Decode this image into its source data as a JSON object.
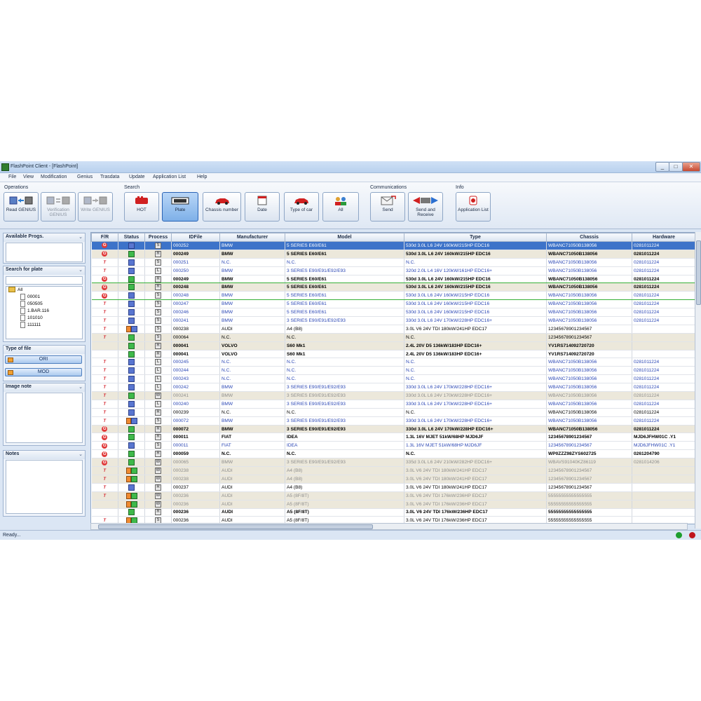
{
  "window": {
    "title": "FlashPoint Client - [FlashPoint]",
    "min": "_",
    "max": "□",
    "close": "✕"
  },
  "menu": [
    "File",
    "View",
    "Modification",
    "Genius",
    "Trasdata",
    "Update",
    "Application List",
    "Help"
  ],
  "toolbar": {
    "groups": {
      "operations": "Operations",
      "search": "Search",
      "communications": "Communications",
      "info": "Info"
    },
    "operations": [
      {
        "label": "Read GENIUS"
      },
      {
        "label": "Verification GENIUS"
      },
      {
        "label": "Write GENIUS"
      }
    ],
    "search": [
      {
        "label": "HOT"
      },
      {
        "label": "Plate"
      },
      {
        "label": "Chassis number"
      },
      {
        "label": "Date"
      },
      {
        "label": "Type of car"
      },
      {
        "label": "All"
      }
    ],
    "communications": [
      {
        "label": "Send"
      },
      {
        "label": "Send and Receive"
      }
    ],
    "info": [
      {
        "label": "Application List"
      }
    ]
  },
  "left": {
    "available": "Available Progs.",
    "search_plate": "Search for plate",
    "tree": [
      "All",
      "00001",
      "050505",
      "1.BAR.116",
      "101010",
      "111111"
    ],
    "type_of_file": "Type of file",
    "ori": "ORI",
    "mod": "MOD",
    "image_note": "Image note",
    "notes": "Notes",
    "chevron": "⌄"
  },
  "grid": {
    "columns": [
      "F/R",
      "Status",
      "Process",
      "IDFile",
      "Manufacturer",
      "Model",
      "Type",
      "Chassis",
      "Hardware"
    ],
    "rows": [
      {
        "fr": "G",
        "st": [
          "b"
        ],
        "pr": "S",
        "id": "000252",
        "man": "BMW",
        "model": "5 SERIES E60/E61",
        "type": "530d 3.0L L6 24V 160kW/215HP EDC16",
        "chassis": "WBANC71050B138056",
        "hw": "0281011224",
        "cls": "sel"
      },
      {
        "fr": "G",
        "st": [
          "g"
        ],
        "pr": "R",
        "id": "000249",
        "man": "BMW",
        "model": "5 SERIES E60/E61",
        "type": "530d 3.0L L6 24V 160kW/215HP EDC16",
        "chassis": "WBANC71050B138056",
        "hw": "0281011224",
        "cls": "bold c-black bg-b"
      },
      {
        "fr": "T",
        "st": [
          "b"
        ],
        "pr": "S",
        "id": "000251",
        "man": "N.C.",
        "model": "N.C.",
        "type": "N.C.",
        "chassis": "WBANC71050B138056",
        "hw": "0281011224",
        "cls": "c-blue bg-w"
      },
      {
        "fr": "T",
        "st": [
          "b"
        ],
        "pr": "L",
        "id": "000250",
        "man": "BMW",
        "model": "3 SERIES E90/E91/E92/E93",
        "type": "320d 2.0L L4 16V 120kW/161HP EDC16+",
        "chassis": "WBANC71050B138056",
        "hw": "0281011224",
        "cls": "c-blue bg-w"
      },
      {
        "fr": "G",
        "st": [
          "g"
        ],
        "pr": "R",
        "id": "000249",
        "man": "BMW",
        "model": "5 SERIES E60/E61",
        "type": "530d 3.0L L6 24V 160kW/215HP EDC16",
        "chassis": "WBANC71050B138056",
        "hw": "0281011224",
        "cls": "bold c-black bg-w grn"
      },
      {
        "fr": "G",
        "st": [
          "g"
        ],
        "pr": "R",
        "id": "000248",
        "man": "BMW",
        "model": "5 SERIES E60/E61",
        "type": "530d 3.0L L6 24V 160kW/215HP EDC16",
        "chassis": "WBANC71050B138056",
        "hw": "0281011224",
        "cls": "bold c-black bg-b"
      },
      {
        "fr": "G",
        "st": [
          "b"
        ],
        "pr": "S",
        "id": "000248",
        "man": "BMW",
        "model": "5 SERIES E60/E61",
        "type": "530d 3.0L L6 24V 160kW/215HP EDC16",
        "chassis": "WBANC71050B138056",
        "hw": "0281011224",
        "cls": "c-blue bg-w grn"
      },
      {
        "fr": "T",
        "st": [
          "b"
        ],
        "pr": "S",
        "id": "000247",
        "man": "BMW",
        "model": "5 SERIES E60/E61",
        "type": "530d 3.0L L6 24V 160kW/215HP EDC16",
        "chassis": "WBANC71050B138056",
        "hw": "0281011224",
        "cls": "c-blue bg-w"
      },
      {
        "fr": "T",
        "st": [
          "b"
        ],
        "pr": "S",
        "id": "000246",
        "man": "BMW",
        "model": "5 SERIES E60/E61",
        "type": "530d 3.0L L6 24V 160kW/215HP EDC16",
        "chassis": "WBANC71050B138056",
        "hw": "0281011224",
        "cls": "c-blue bg-w"
      },
      {
        "fr": "T",
        "st": [
          "b"
        ],
        "pr": "S",
        "id": "000241",
        "man": "BMW",
        "model": "3 SERIES E90/E91/E92/E93",
        "type": "330d 3.0L L6 24V 170kW/228HP EDC16+",
        "chassis": "WBANC71050B138056",
        "hw": "0281011224",
        "cls": "c-blue bg-w"
      },
      {
        "fr": "T",
        "st": [
          "o",
          "b"
        ],
        "pr": "S",
        "id": "000238",
        "man": "AUDI",
        "model": "A4 (B8)",
        "type": "3.0L V6 24V TDI 180kW/241HP EDC17",
        "chassis": "12345678901234567",
        "hw": "",
        "cls": "c-black bg-w"
      },
      {
        "fr": "T",
        "st": [
          "g"
        ],
        "pr": "S",
        "id": "000064",
        "man": "N.C.",
        "model": "N.C.",
        "type": "N.C.",
        "chassis": "12345678901234567",
        "hw": "",
        "cls": "c-black bg-b"
      },
      {
        "fr": "",
        "st": [
          "g"
        ],
        "pr": "R",
        "id": "000041",
        "man": "VOLVO",
        "model": "S60 Mk1",
        "type": "2.4L 20V D5 136kW/183HP EDC16+",
        "chassis": "YV1RS714092720720",
        "hw": "",
        "cls": "bold c-black bg-b"
      },
      {
        "fr": "",
        "st": [
          "g"
        ],
        "pr": "R",
        "id": "000041",
        "man": "VOLVO",
        "model": "S60 Mk1",
        "type": "2.4L 20V D5 136kW/183HP EDC16+",
        "chassis": "YV1RS714092720720",
        "hw": "",
        "cls": "bold c-black bg-w"
      },
      {
        "fr": "T",
        "st": [
          "b"
        ],
        "pr": "L",
        "id": "000245",
        "man": "N.C.",
        "model": "N.C.",
        "type": "N.C.",
        "chassis": "WBANC71050B138056",
        "hw": "0281011224",
        "cls": "c-blue bg-w"
      },
      {
        "fr": "T",
        "st": [
          "b"
        ],
        "pr": "L",
        "id": "000244",
        "man": "N.C.",
        "model": "N.C.",
        "type": "N.C.",
        "chassis": "WBANC71050B138056",
        "hw": "0281011224",
        "cls": "c-blue bg-w"
      },
      {
        "fr": "T",
        "st": [
          "b"
        ],
        "pr": "L",
        "id": "000243",
        "man": "N.C.",
        "model": "N.C.",
        "type": "N.C.",
        "chassis": "WBANC71050B138056",
        "hw": "0281011224",
        "cls": "c-blue bg-w"
      },
      {
        "fr": "T",
        "st": [
          "b"
        ],
        "pr": "L",
        "id": "000242",
        "man": "BMW",
        "model": "3 SERIES E90/E91/E92/E93",
        "type": "330d 3.0L L6 24V 170kW/228HP EDC16+",
        "chassis": "WBANC71050B138056",
        "hw": "0281011224",
        "cls": "c-blue bg-w"
      },
      {
        "fr": "T",
        "st": [
          "g"
        ],
        "pr": "W",
        "id": "000241",
        "man": "BMW",
        "model": "3 SERIES E90/E91/E92/E93",
        "type": "330d 3.0L L6 24V 170kW/228HP EDC16+",
        "chassis": "WBANC71050B138056",
        "hw": "0281011224",
        "cls": "c-gray bg-b"
      },
      {
        "fr": "T",
        "st": [
          "b"
        ],
        "pr": "L",
        "id": "000240",
        "man": "BMW",
        "model": "3 SERIES E90/E91/E92/E93",
        "type": "330d 3.0L L6 24V 170kW/228HP EDC16+",
        "chassis": "WBANC71050B138056",
        "hw": "0281011224",
        "cls": "c-blue bg-w"
      },
      {
        "fr": "T",
        "st": [
          "b"
        ],
        "pr": "R",
        "id": "000239",
        "man": "N.C.",
        "model": "N.C.",
        "type": "N.C.",
        "chassis": "WBANC71050B138056",
        "hw": "0281011224",
        "cls": "c-black bg-w"
      },
      {
        "fr": "T",
        "st": [
          "o",
          "b"
        ],
        "pr": "S",
        "id": "000072",
        "man": "BMW",
        "model": "3 SERIES E90/E91/E92/E93",
        "type": "330d 3.0L L6 24V 170kW/228HP EDC16+",
        "chassis": "WBANC71050B138056",
        "hw": "0281011224",
        "cls": "c-blue bg-w"
      },
      {
        "fr": "G",
        "st": [
          "g"
        ],
        "pr": "R",
        "id": "000072",
        "man": "BMW",
        "model": "3 SERIES E90/E91/E92/E93",
        "type": "330d 3.0L L6 24V 170kW/228HP EDC16+",
        "chassis": "WBANC71050B138056",
        "hw": "0281011224",
        "cls": "bold c-black bg-b"
      },
      {
        "fr": "G",
        "st": [
          "g"
        ],
        "pr": "R",
        "id": "000011",
        "man": "FIAT",
        "model": "IDEA",
        "type": "1.3L 16V MJET 51kW/68HP MJD6JF",
        "chassis": "12345678901234567",
        "hw": "MJD6JFHW01C .Y1",
        "cls": "bold c-black bg-w"
      },
      {
        "fr": "G",
        "st": [
          "b"
        ],
        "pr": "S",
        "id": "000011",
        "man": "FIAT",
        "model": "IDEA",
        "type": "1.3L 16V MJET 51kW/68HP MJD6JF",
        "chassis": "12345678901234567",
        "hw": "MJD6JFHW01C .Y1",
        "cls": "c-blue bg-w"
      },
      {
        "fr": "G",
        "st": [
          "g"
        ],
        "pr": "R",
        "id": "000059",
        "man": "N.C.",
        "model": "N.C.",
        "type": "N.C.",
        "chassis": "WP0ZZZ98ZYS602725",
        "hw": "0261204790",
        "cls": "bold c-black bg-w"
      },
      {
        "fr": "G",
        "st": [
          "g"
        ],
        "pr": "W",
        "id": "000065",
        "man": "BMW",
        "model": "3 SERIES E90/E91/E92/E93",
        "type": "335d 3.0L L6 24V 210kW/282HP EDC16+",
        "chassis": "WBAVS91040KZ86119",
        "hw": "0281014206",
        "cls": "c-gray bg-b"
      },
      {
        "fr": "T",
        "st": [
          "o",
          "g"
        ],
        "pr": "W",
        "id": "000238",
        "man": "AUDI",
        "model": "A4 (B8)",
        "type": "3.0L V6 24V TDI 180kW/241HP EDC17",
        "chassis": "12345678901234567",
        "hw": "",
        "cls": "c-gray bg-b"
      },
      {
        "fr": "T",
        "st": [
          "o",
          "g"
        ],
        "pr": "W",
        "id": "000238",
        "man": "AUDI",
        "model": "A4 (B8)",
        "type": "3.0L V6 24V TDI 180kW/241HP EDC17",
        "chassis": "12345678901234567",
        "hw": "",
        "cls": "c-gray bg-b"
      },
      {
        "fr": "T",
        "st": [
          "b"
        ],
        "pr": "R",
        "id": "000237",
        "man": "AUDI",
        "model": "A4 (B8)",
        "type": "3.0L V6 24V TDI 180kW/241HP EDC17",
        "chassis": "12345678901234567",
        "hw": "",
        "cls": "c-black bg-w"
      },
      {
        "fr": "T",
        "st": [
          "o",
          "g"
        ],
        "pr": "W",
        "id": "000236",
        "man": "AUDI",
        "model": "A5 (8F/8T)",
        "type": "3.0L V6 24V TDI 176kW/236HP EDC17",
        "chassis": "55555555555555555",
        "hw": "",
        "cls": "c-gray bg-b"
      },
      {
        "fr": "",
        "st": [
          "o",
          "g"
        ],
        "pr": "W",
        "id": "000236",
        "man": "AUDI",
        "model": "A5 (8F/8T)",
        "type": "3.0L V6 24V TDI 176kW/236HP EDC17",
        "chassis": "55555555555555555",
        "hw": "",
        "cls": "c-gray bg-b"
      },
      {
        "fr": "",
        "st": [
          "g"
        ],
        "pr": "R",
        "id": "000236",
        "man": "AUDI",
        "model": "A5 (8F/8T)",
        "type": "3.0L V6 24V TDI 176kW/236HP EDC17",
        "chassis": "55555555555555555",
        "hw": "",
        "cls": "bold c-black bg-w"
      },
      {
        "fr": "T",
        "st": [
          "o",
          "g"
        ],
        "pr": "S",
        "id": "000236",
        "man": "AUDI",
        "model": "A5 (8F/8T)",
        "type": "3.0L V6 24V TDI 176kW/236HP EDC17",
        "chassis": "55555555555555555",
        "hw": "",
        "cls": "c-black bg-w"
      }
    ]
  },
  "status": {
    "text": "Ready..."
  },
  "colors": {
    "selected": "#3d73c9",
    "blue_text": "#2b47b5",
    "beige": "#ece8db",
    "led_green": "#1e9e2e",
    "led_red": "#c0141c"
  }
}
